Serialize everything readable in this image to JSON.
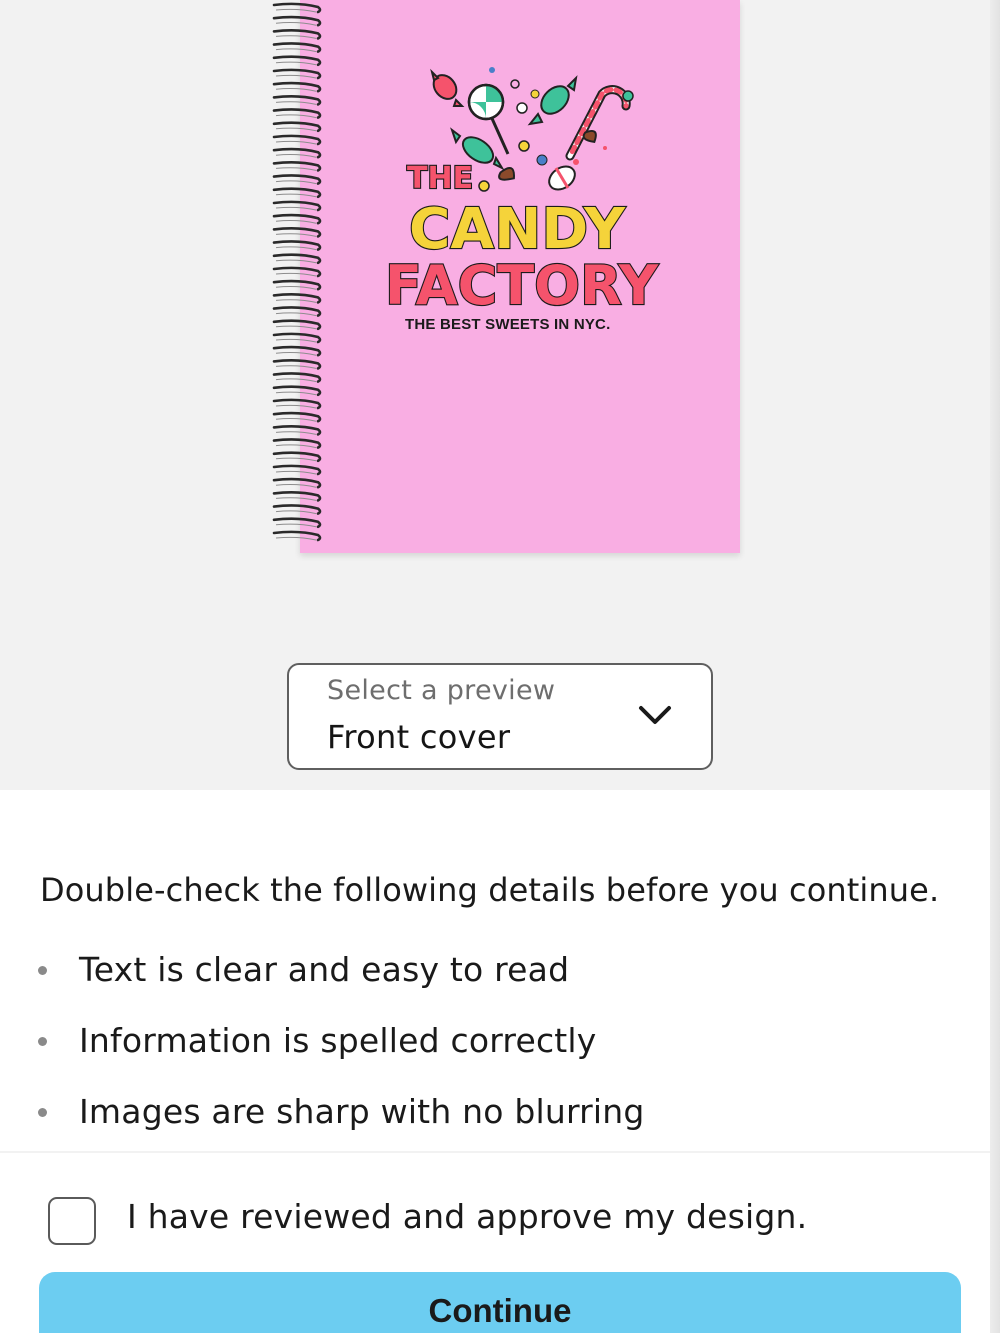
{
  "preview": {
    "cover_color": "#f9aee3",
    "logo_the": "THE",
    "logo_candy": "CANDY",
    "logo_factory": "FACTORY",
    "tagline": "THE BEST SWEETS IN NYC."
  },
  "preview_select": {
    "label": "Select a preview",
    "selected": "Front cover"
  },
  "details": {
    "intro": "Double-check the following details before you continue.",
    "items": [
      "Text is clear and easy to read",
      "Information is spelled correctly",
      "Images are sharp with no blurring"
    ]
  },
  "approval": {
    "checkbox_label": "I have reviewed and approve my design.",
    "checked": false
  },
  "continue_button": {
    "label": "Continue",
    "color": "#6ccdf1"
  }
}
